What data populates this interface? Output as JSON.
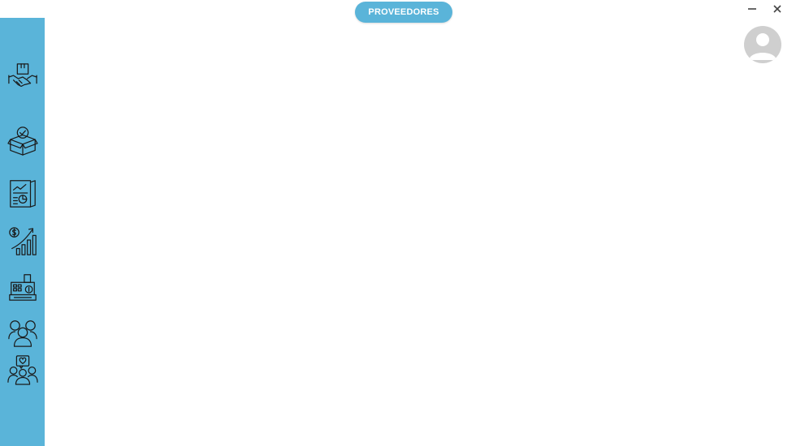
{
  "header": {
    "title": "PROVEEDORES",
    "accent_color": "#5ab4d9"
  },
  "window_controls": {
    "minimize_icon": "minimize-icon",
    "close_icon": "close-icon"
  },
  "user": {
    "avatar_icon": "user-avatar-icon"
  },
  "sidebar": {
    "background": "#5ab4d9",
    "items": [
      {
        "name": "suppliers",
        "icon": "handshake-box-icon"
      },
      {
        "name": "products",
        "icon": "box-check-icon"
      },
      {
        "name": "reports",
        "icon": "report-chart-icon"
      },
      {
        "name": "finance",
        "icon": "money-growth-icon"
      },
      {
        "name": "cash-register",
        "icon": "cash-register-icon"
      },
      {
        "name": "groups",
        "icon": "people-group-icon"
      },
      {
        "name": "clients",
        "icon": "people-heart-icon"
      }
    ]
  }
}
